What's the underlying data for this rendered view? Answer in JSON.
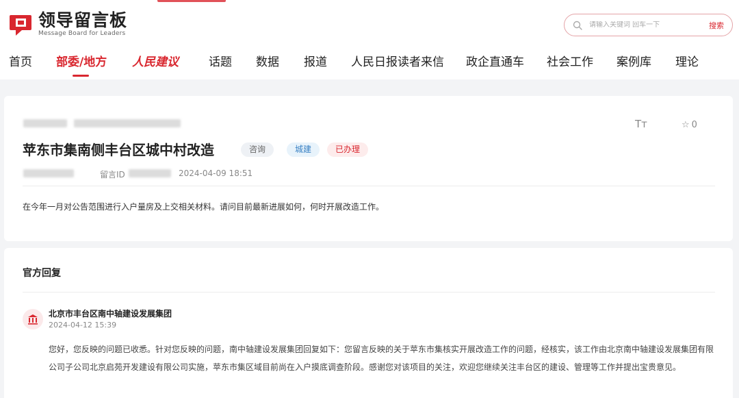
{
  "site": {
    "title": "领导留言板",
    "subtitle": "Message Board for Leaders",
    "brand_color": "#d9272f"
  },
  "search": {
    "placeholder": "请输入关键词 回车一下",
    "button_label": "搜索",
    "icon": "search-icon"
  },
  "nav": {
    "items": [
      {
        "label": "首页"
      },
      {
        "label": "部委/地方",
        "active": true
      },
      {
        "label": "人民建议"
      },
      {
        "label": "话题"
      },
      {
        "label": "数据"
      },
      {
        "label": "报道"
      },
      {
        "label": "人民日报读者来信"
      },
      {
        "label": "政企直通车"
      },
      {
        "label": "社会工作"
      },
      {
        "label": "案例库"
      },
      {
        "label": "理论"
      }
    ]
  },
  "message": {
    "title": "苹东市集南侧丰台区城中村改造",
    "tags": {
      "consult": "咨询",
      "city": "城建",
      "status": "已办理"
    },
    "id_label": "留言ID",
    "datetime": "2024-04-09 18:51",
    "font_size_label": "Tт",
    "favorite_count": "0",
    "content": "在今年一月对公告范围进行入户量房及上交相关材料。请问目前最新进展如何，何时开展改造工作。"
  },
  "reply": {
    "section_title": "官方回复",
    "org_name": "北京市丰台区南中轴建设发展集团",
    "org_icon": "government-building-icon",
    "datetime": "2024-04-12 15:39",
    "text": "您好，您反映的问题已收悉。针对您反映的问题，南中轴建设发展集团回复如下：您留言反映的关于苹东市集核实开展改造工作的问题，经核实，该工作由北京南中轴建设发展集团有限公司子公司北京启苑开发建设有限公司实施，苹东市集区域目前尚在入户摸底调查阶段。感谢您对该项目的关注，欢迎您继续关注丰台区的建设、管理等工作并提出宝贵意见。"
  }
}
